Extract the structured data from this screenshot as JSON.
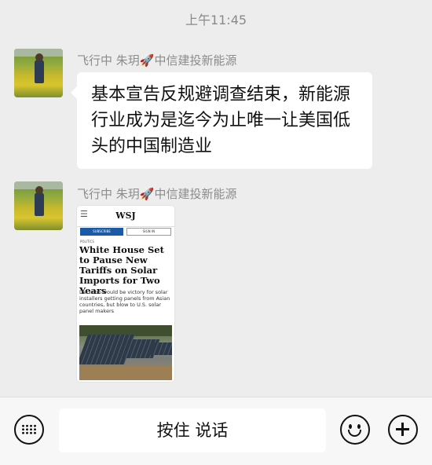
{
  "status": {
    "time": "上午11:45"
  },
  "messages": [
    {
      "sender": "飞行中 朱玥🚀中信建投新能源",
      "text": "基本宣告反规避调查结束，新能源行业成为是迄今为止唯一让美国低头的中国制造业"
    },
    {
      "sender": "飞行中 朱玥🚀中信建投新能源",
      "image": {
        "menu_icon": "hamburger-icon",
        "logo": "WSJ",
        "subscribe": "SUBSCRIBE",
        "sign_in": "SIGN IN",
        "section": "POLITICS",
        "headline": "White House Set to Pause New Tariffs on Solar Imports for Two Years",
        "dek": "Decision would be victory for solar installers getting panels from Asian countries, but blow to U.S. solar panel makers"
      }
    }
  ],
  "input_bar": {
    "keyboard_icon": "keyboard-icon",
    "hold_to_talk": "按住 说话",
    "emoji_icon": "emoji-icon",
    "plus_icon": "plus-icon"
  }
}
